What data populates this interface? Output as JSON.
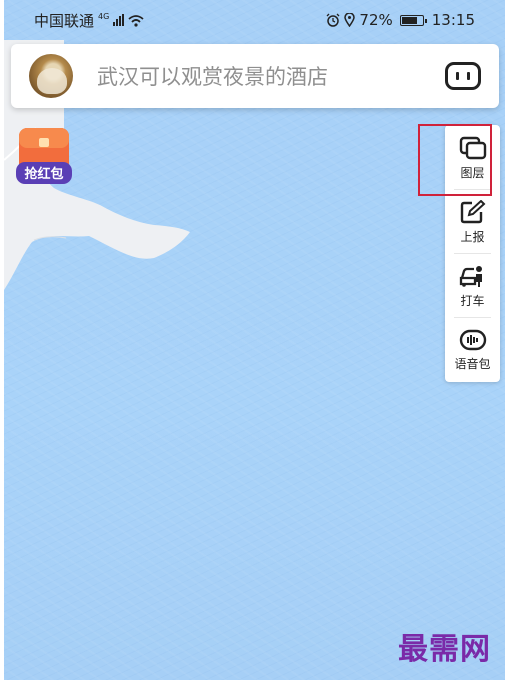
{
  "status_bar": {
    "carrier": "中国联通",
    "network": "4G",
    "battery": "72%",
    "time": "13:15"
  },
  "search": {
    "placeholder": "武汉可以观赏夜景的酒店"
  },
  "red_packet": {
    "label": "抢红包"
  },
  "side_tools": {
    "items": [
      {
        "label": "图层",
        "icon": "layers-icon"
      },
      {
        "label": "上报",
        "icon": "report-edit-icon"
      },
      {
        "label": "打车",
        "icon": "taxi-icon"
      },
      {
        "label": "语音包",
        "icon": "voice-pack-icon"
      }
    ]
  },
  "watermark": "最需网",
  "colors": {
    "water": "#a9d2f8",
    "land": "#eef0f3",
    "highlight": "#d0223a",
    "watermark": "#7a2aa8"
  }
}
